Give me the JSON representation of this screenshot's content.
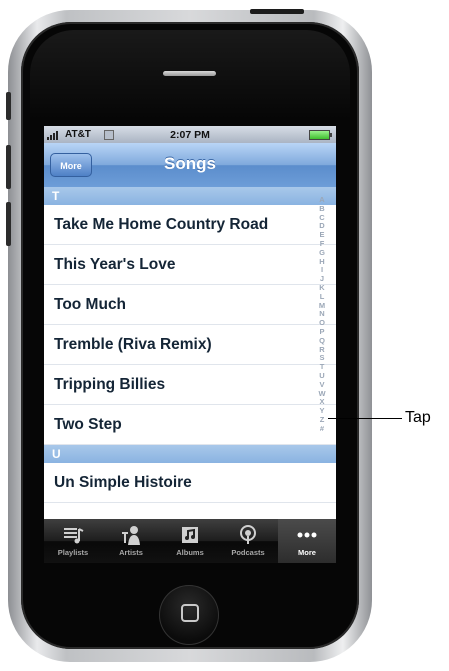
{
  "status_bar": {
    "carrier": "AT&T",
    "time": "2:07 PM"
  },
  "nav_bar": {
    "back_label": "More",
    "title": "Songs"
  },
  "song_list": {
    "sections": [
      {
        "header": "T",
        "songs": [
          "Take Me Home Country Road",
          "This Year's Love",
          "Too Much",
          "Tremble (Riva Remix)",
          "Tripping Billies",
          "Two Step"
        ]
      },
      {
        "header": "U",
        "songs": [
          "Un Simple Histoire"
        ]
      }
    ]
  },
  "index_letters": [
    "A",
    "B",
    "C",
    "D",
    "E",
    "F",
    "G",
    "H",
    "I",
    "J",
    "K",
    "L",
    "M",
    "N",
    "O",
    "P",
    "Q",
    "R",
    "S",
    "T",
    "U",
    "V",
    "W",
    "X",
    "Y",
    "Z",
    "#"
  ],
  "tab_bar": {
    "items": [
      {
        "label": "Playlists",
        "icon": "playlists-icon"
      },
      {
        "label": "Artists",
        "icon": "artists-icon"
      },
      {
        "label": "Albums",
        "icon": "albums-icon"
      },
      {
        "label": "Podcasts",
        "icon": "podcasts-icon"
      },
      {
        "label": "More",
        "icon": "more-icon"
      }
    ],
    "selected": "More"
  },
  "annotation": {
    "callout_label": "Tap"
  },
  "colors": {
    "nav_blue": "#6d9dd8",
    "section_header_blue": "#8ab3e1",
    "tab_bar_black": "#111111"
  }
}
